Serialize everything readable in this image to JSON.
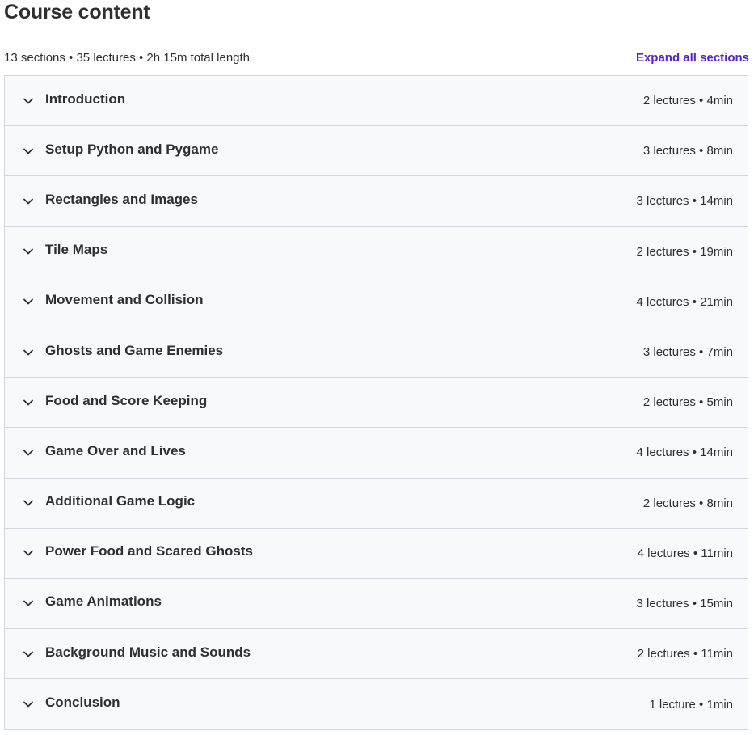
{
  "header": {
    "title": "Course content"
  },
  "summary": {
    "text": "13 sections • 35 lectures • 2h 15m total length",
    "expand_label": "Expand all sections"
  },
  "colors": {
    "accent": "#5624d0",
    "row_background": "#f7f9fa",
    "border": "#d1d7dc",
    "text": "#2d2f31"
  },
  "icons": {
    "section_toggle": "chevron-down-icon"
  },
  "sections": [
    {
      "title": "Introduction",
      "meta": "2 lectures • 4min"
    },
    {
      "title": "Setup Python and Pygame",
      "meta": "3 lectures • 8min"
    },
    {
      "title": "Rectangles and Images",
      "meta": "3 lectures • 14min"
    },
    {
      "title": "Tile Maps",
      "meta": "2 lectures • 19min"
    },
    {
      "title": "Movement and Collision",
      "meta": "4 lectures • 21min"
    },
    {
      "title": "Ghosts and Game Enemies",
      "meta": "3 lectures • 7min"
    },
    {
      "title": "Food and Score Keeping",
      "meta": "2 lectures • 5min"
    },
    {
      "title": "Game Over and Lives",
      "meta": "4 lectures • 14min"
    },
    {
      "title": "Additional Game Logic",
      "meta": "2 lectures • 8min"
    },
    {
      "title": "Power Food and Scared Ghosts",
      "meta": "4 lectures • 11min"
    },
    {
      "title": "Game Animations",
      "meta": "3 lectures • 15min"
    },
    {
      "title": "Background Music and Sounds",
      "meta": "2 lectures • 11min"
    },
    {
      "title": "Conclusion",
      "meta": "1 lecture • 1min"
    }
  ]
}
